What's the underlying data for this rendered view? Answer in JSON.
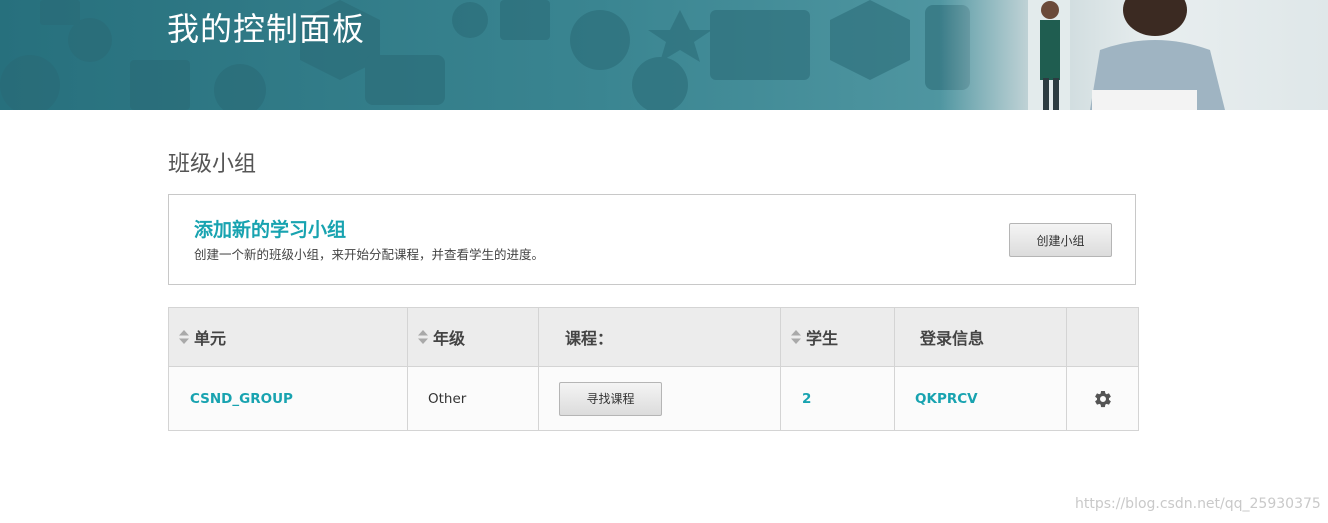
{
  "banner": {
    "title": "我的控制面板"
  },
  "section": {
    "title": "班级小组"
  },
  "add_group": {
    "title": "添加新的学习小组",
    "description": "创建一个新的班级小组，来开始分配课程，并查看学生的进度。",
    "button_label": "创建小组"
  },
  "table": {
    "headers": {
      "unit": "单元",
      "grade": "年级",
      "course": "课程：",
      "students": "学生",
      "login": "登录信息"
    },
    "rows": [
      {
        "unit": "CSND_GROUP",
        "grade": "Other",
        "course_button": "寻找课程",
        "students": "2",
        "login": "QKPRCV"
      }
    ]
  },
  "watermark": "https://blog.csdn.net/qq_25930375",
  "colors": {
    "accent": "#18a3b0",
    "banner": "#3a8591"
  }
}
